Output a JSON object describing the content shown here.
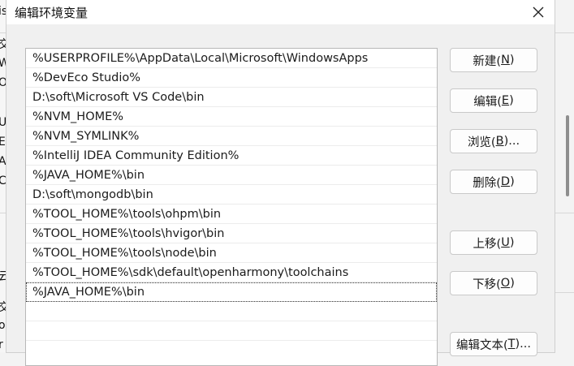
{
  "dialog": {
    "title": "编辑环境变量"
  },
  "paths": [
    "%USERPROFILE%\\AppData\\Local\\Microsoft\\WindowsApps",
    "%DevEco Studio%",
    "D:\\soft\\Microsoft VS Code\\bin",
    "%NVM_HOME%",
    "%NVM_SYMLINK%",
    "%IntelliJ IDEA Community Edition%",
    "%JAVA_HOME%\\bin",
    "D:\\soft\\mongodb\\bin",
    "%TOOL_HOME%\\tools\\ohpm\\bin",
    "%TOOL_HOME%\\tools\\hvigor\\bin",
    "%TOOL_HOME%\\tools\\node\\bin",
    "%TOOL_HOME%\\sdk\\default\\openharmony\\toolchains",
    "%JAVA_HOME%\\bin"
  ],
  "buttons": {
    "new": {
      "text": "新建(",
      "key": "N",
      "tail": ")"
    },
    "edit": {
      "text": "编辑(",
      "key": "E",
      "tail": ")"
    },
    "browse": {
      "text": "浏览(",
      "key": "B",
      "tail": ")..."
    },
    "delete": {
      "text": "删除(",
      "key": "D",
      "tail": ")"
    },
    "up": {
      "text": "上移(",
      "key": "U",
      "tail": ")"
    },
    "down": {
      "text": "下移(",
      "key": "O",
      "tail": ")"
    },
    "edit_text": {
      "text": "编辑文本(",
      "key": "T",
      "tail": ")..."
    }
  },
  "background_fragments": [
    "is",
    "交",
    "W",
    "Or",
    "U",
    "E",
    "A",
    "C",
    "云",
    "交",
    "o",
    "r"
  ]
}
